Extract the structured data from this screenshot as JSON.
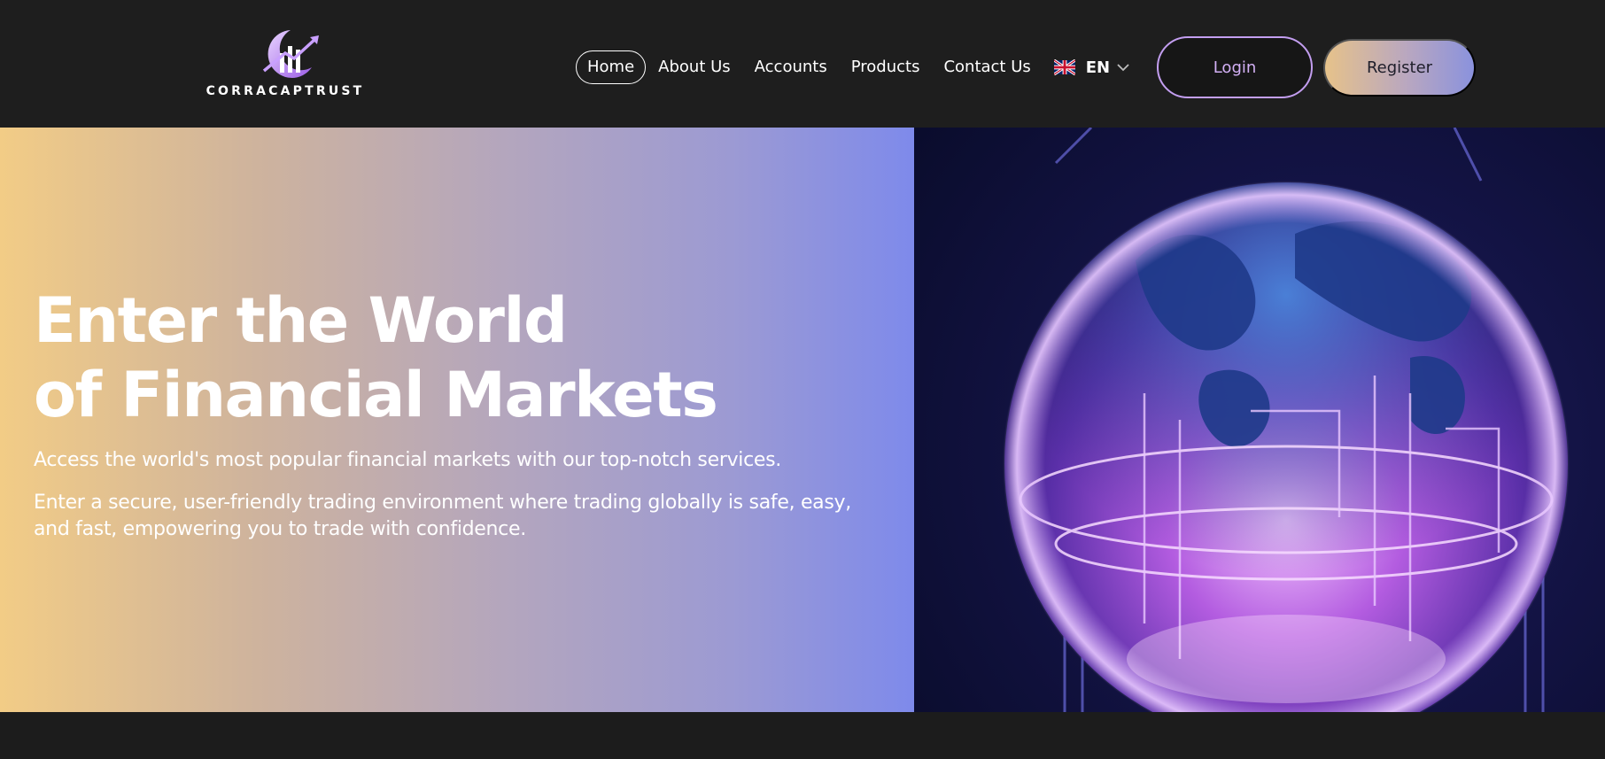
{
  "brand": {
    "name": "CORRACAPTRUST",
    "logo_icon": "rising-chart-moon-logo-icon"
  },
  "nav": {
    "items": [
      {
        "label": "Home",
        "active": true
      },
      {
        "label": "About Us"
      },
      {
        "label": "Accounts"
      },
      {
        "label": "Products"
      },
      {
        "label": "Contact Us"
      }
    ],
    "language": {
      "code": "EN",
      "flag_icon": "uk-flag-icon",
      "dropdown_icon": "chevron-down-icon"
    }
  },
  "actions": {
    "login_label": "Login",
    "register_label": "Register"
  },
  "hero": {
    "title_line1": "Enter the World",
    "title_line2": "of Financial Markets",
    "paragraph1": "Access the world's most popular financial markets with our top-notch services.",
    "paragraph2": "Enter a secure, user-friendly trading environment where trading globally is safe, easy, and fast, empowering you to trade with confidence.",
    "image_icon": "glowing-globe-illustration"
  },
  "colors": {
    "header_bg": "#1e1e1e",
    "login_border": "#c39ef0",
    "gradient_start": "#f2cc86",
    "gradient_end": "#7e8aeb",
    "globe_glow": "#c77dff"
  }
}
